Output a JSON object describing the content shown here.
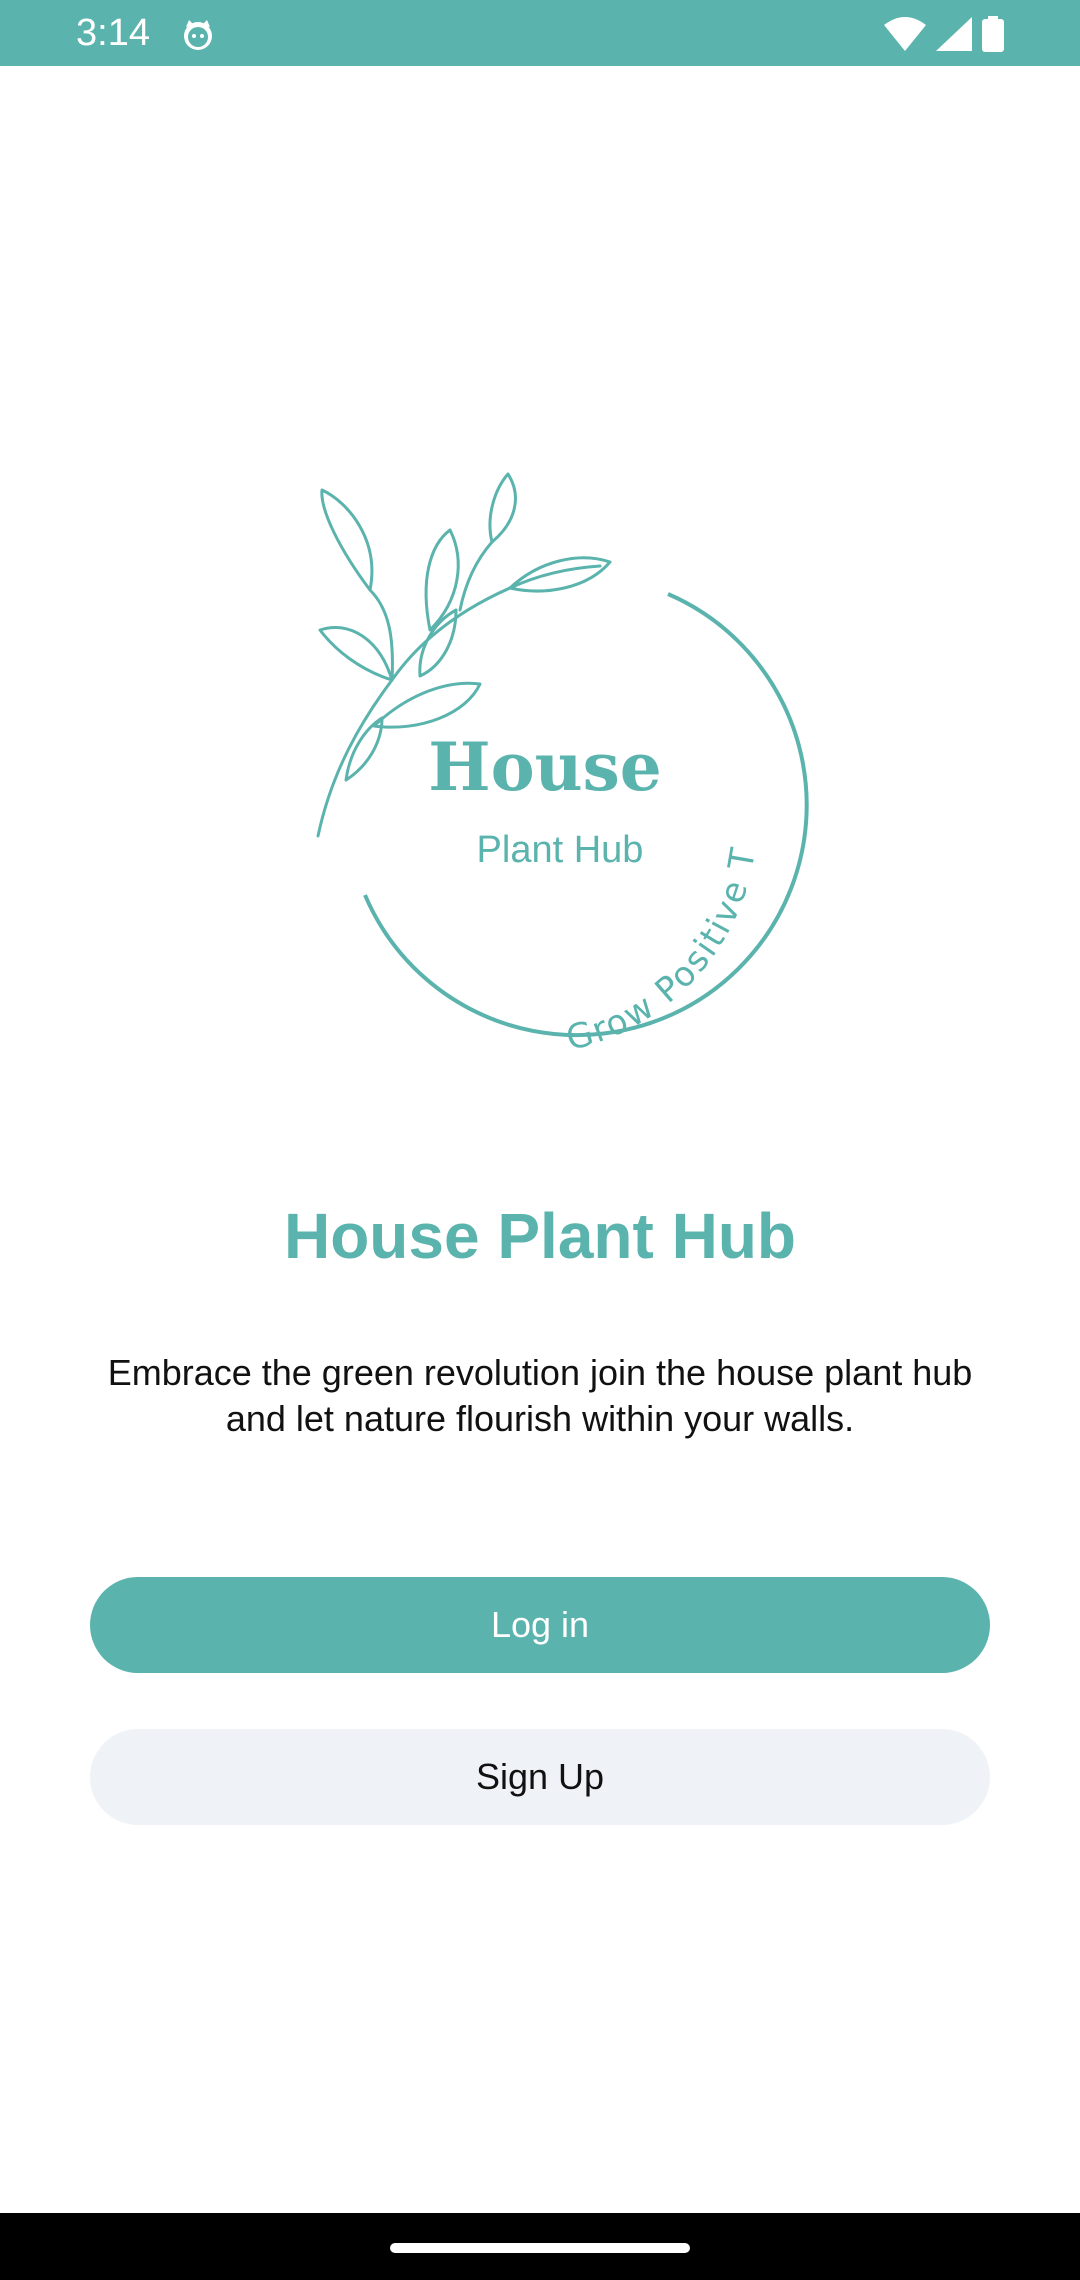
{
  "status_bar": {
    "time": "3:14",
    "app_icon": "cat-face-icon",
    "wifi_icon": "wifi-icon",
    "signal_icon": "cell-signal-icon",
    "battery_icon": "battery-icon"
  },
  "logo": {
    "brand_word": "House",
    "brand_sub": "Plant Hub",
    "slogan": "Grow Positive Thoughts",
    "icon": "leaf-branch-icon"
  },
  "welcome": {
    "title": "House Plant Hub",
    "tagline_line1": "Embrace the green revolution join the house plant hub",
    "tagline_line2": "and let nature flourish within your walls."
  },
  "actions": {
    "login_label": "Log in",
    "signup_label": "Sign Up"
  },
  "colors": {
    "brand_teal": "#5bb3ad",
    "secondary_button": "#eff3f7"
  }
}
